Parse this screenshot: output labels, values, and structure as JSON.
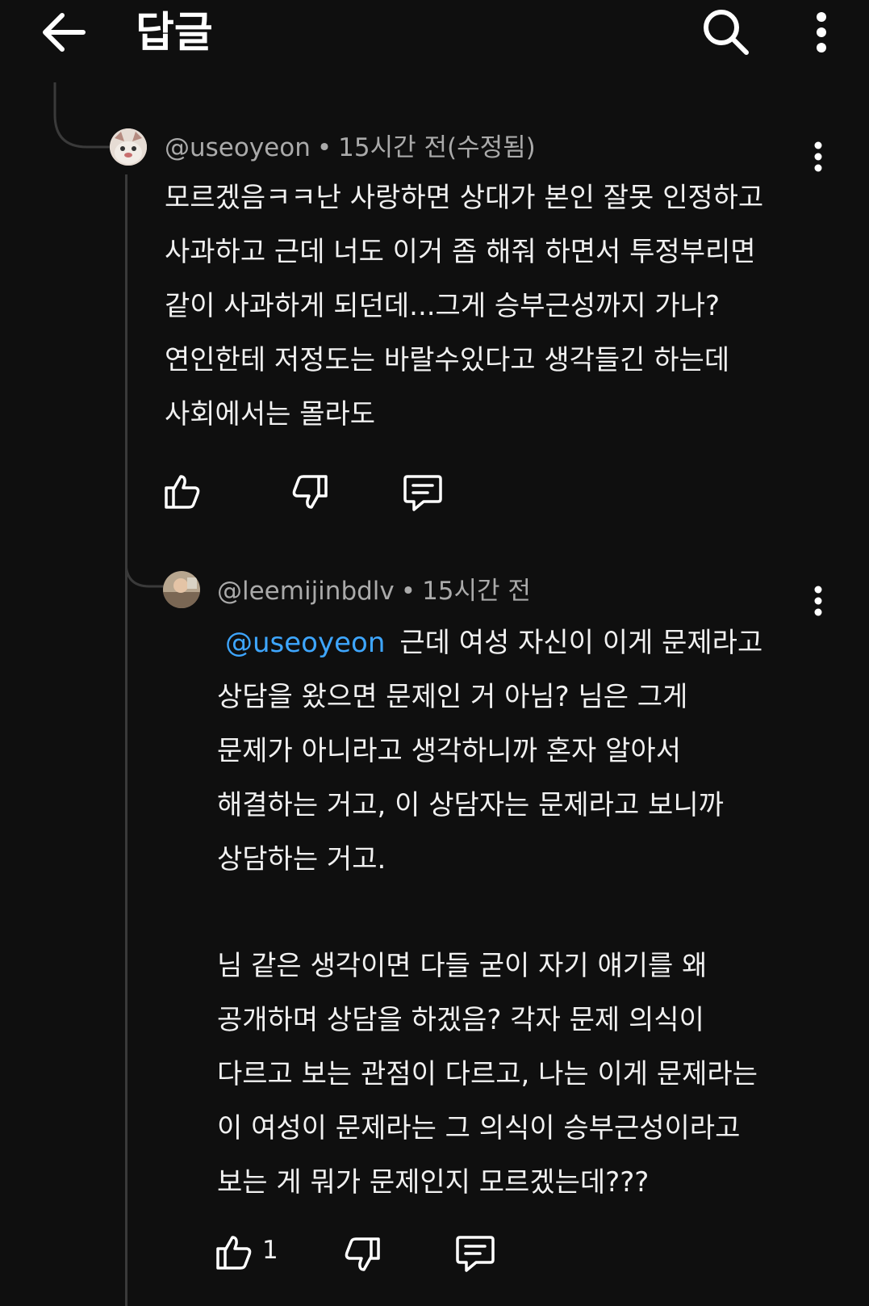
{
  "header": {
    "back_icon": "arrow-left-icon",
    "title": "답글",
    "search_icon": "search-icon",
    "more_icon": "more-vert-icon"
  },
  "comments": [
    {
      "author": "@useoyeon",
      "separator": "•",
      "time": "15시간 전(수정됨)",
      "lines": [
        "모르겠음ㅋㅋ난 사랑하면 상대가 본인 잘못 인정하고",
        "사과하고 근데 너도 이거 좀 해줘 하면서 투정부리면",
        "같이 사과하게 되던데...그게 승부근성까지 가나?",
        "연인한테 저정도는 바랄수있다고 생각들긴 하는데",
        "사회에서는 몰라도"
      ],
      "like_count": ""
    },
    {
      "author": "@leemijinbdlv",
      "separator": "•",
      "time": "15시간 전",
      "mention": "@useoyeon",
      "first_line_rest": "근데 여성 자신이 이게 문제라고",
      "lines": [
        "상담을 왔으면 문제인 거 아님? 님은 그게",
        "문제가 아니라고 생각하니까 혼자 알아서",
        "해결하는 거고, 이 상담자는 문제라고 보니까",
        "상담하는 거고.",
        "",
        "님 같은 생각이면 다들 굳이 자기 얘기를 왜",
        "공개하며 상담을 하겠음? 각자 문제 의식이",
        "다르고 보는 관점이 다르고, 나는 이게 문제라는",
        "이 여성이 문제라는 그 의식이 승부근성이라고",
        "보는 게 뭐가 문제인지 모르겠는데???"
      ],
      "like_count": "1"
    }
  ],
  "colors": {
    "background": "#0f0f0f",
    "text": "#f1f1f1",
    "meta": "#aaaaaa",
    "mention": "#3ea6ff",
    "thread_line": "#3a3a3a"
  }
}
